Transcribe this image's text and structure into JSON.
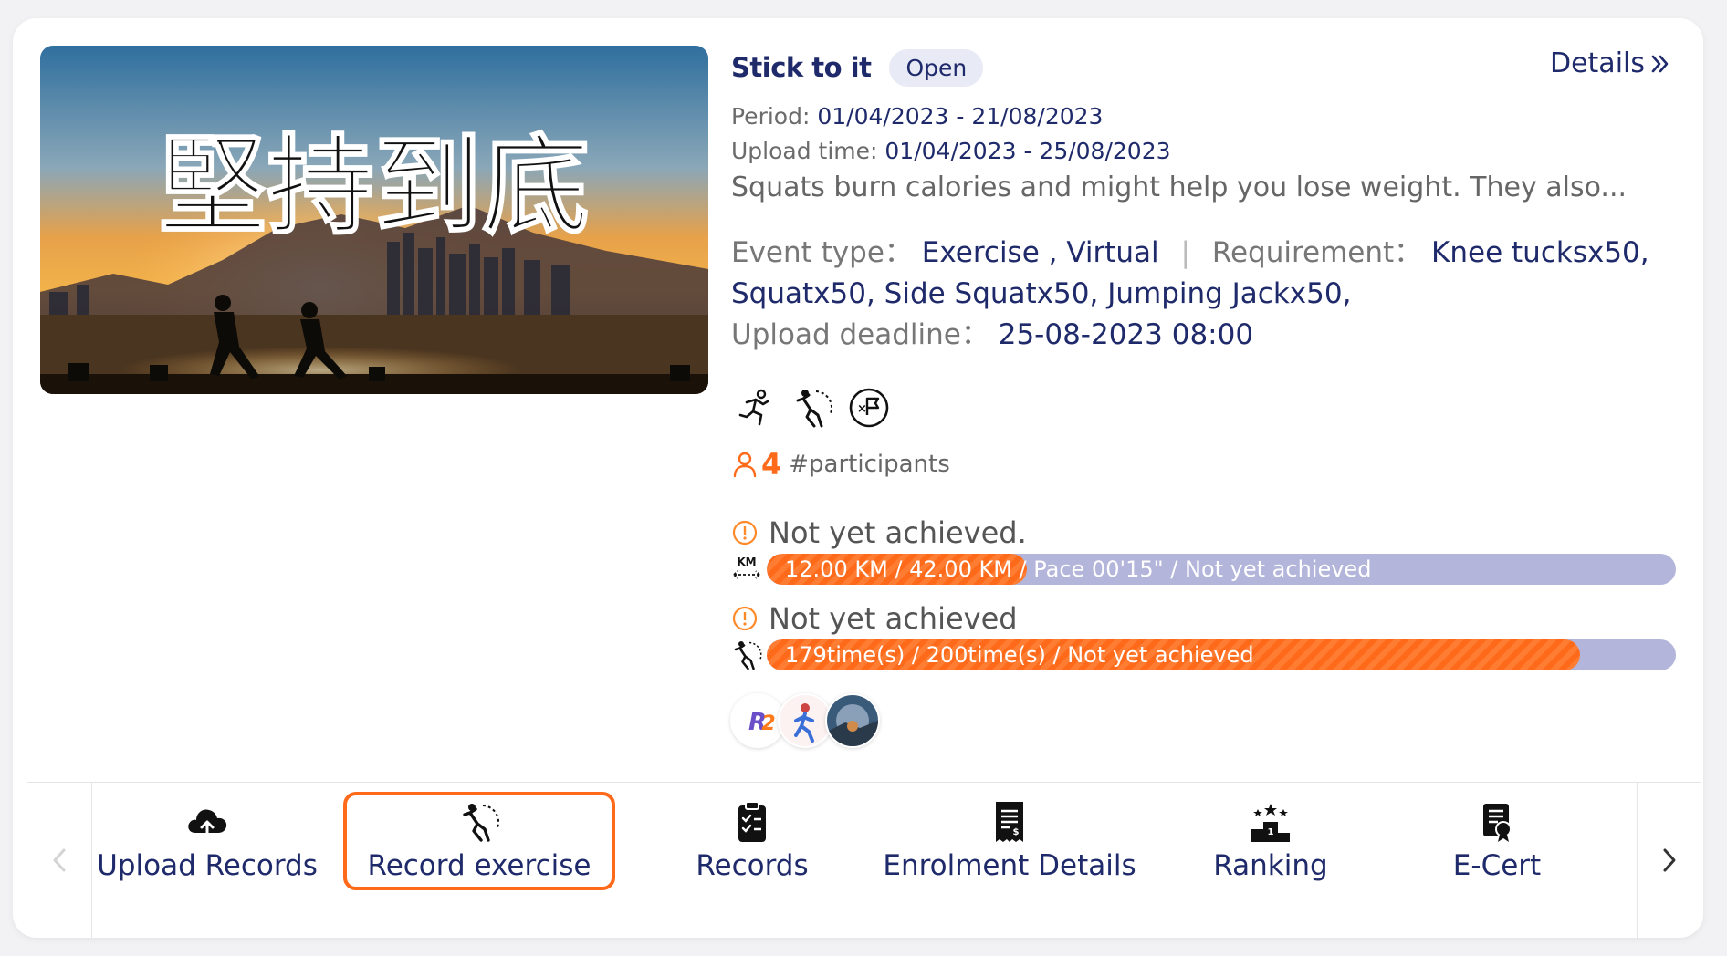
{
  "event": {
    "title": "Stick to it",
    "status_badge": "Open",
    "details_label": "Details",
    "period_label": "Period:",
    "period_value": "01/04/2023 - 21/08/2023",
    "upload_label": "Upload time:",
    "upload_value": "01/04/2023 - 25/08/2023",
    "description": "Squats burn calories and might help you lose weight. They also...",
    "event_type_label": "Event type：",
    "event_type_value": "Exercise , Virtual",
    "separator": "|",
    "requirement_label": "Requirement：",
    "requirement_value_1": "Knee tucksx50,",
    "requirement_value_2": "Squatx50, Side Squatx50, Jumping Jackx50,",
    "deadline_label": "Upload deadline：",
    "deadline_value": "25-08-2023 08:00",
    "banner_text": "堅持到底",
    "sport_icons": [
      "running-icon",
      "squat-exercise-icon",
      "no-flag-icon"
    ],
    "participants_count": "4",
    "participants_label": "#participants"
  },
  "progress": [
    {
      "status": "Not yet achieved.",
      "icon": "km-distance-icon",
      "text": "12.00 KM / 42.00 KM / Pace 00'15\" / Not yet achieved",
      "fraction": 0.2857
    },
    {
      "status": "Not yet achieved",
      "icon": "squat-exercise-icon",
      "text": "179time(s) / 200time(s) / Not yet achieved",
      "fraction": 0.895
    }
  ],
  "avatars": [
    "R2-logo-avatar",
    "runner-avatar",
    "landscape-avatar"
  ],
  "tabs": [
    {
      "label": "Upload Records",
      "icon": "cloud-upload-icon",
      "active": false
    },
    {
      "label": "Record exercise",
      "icon": "squat-exercise-icon",
      "active": true
    },
    {
      "label": "Records",
      "icon": "clipboard-check-icon",
      "active": false
    },
    {
      "label": "Enrolment Details",
      "icon": "receipt-icon",
      "active": false
    },
    {
      "label": "Ranking",
      "icon": "podium-icon",
      "active": false
    },
    {
      "label": "E-Cert",
      "icon": "certificate-icon",
      "active": false
    }
  ],
  "colors": {
    "accent": "#ff6a1a",
    "navy": "#1f2a6b",
    "bar_track": "#b3b5da",
    "badge_bg": "#e8eaf6"
  }
}
